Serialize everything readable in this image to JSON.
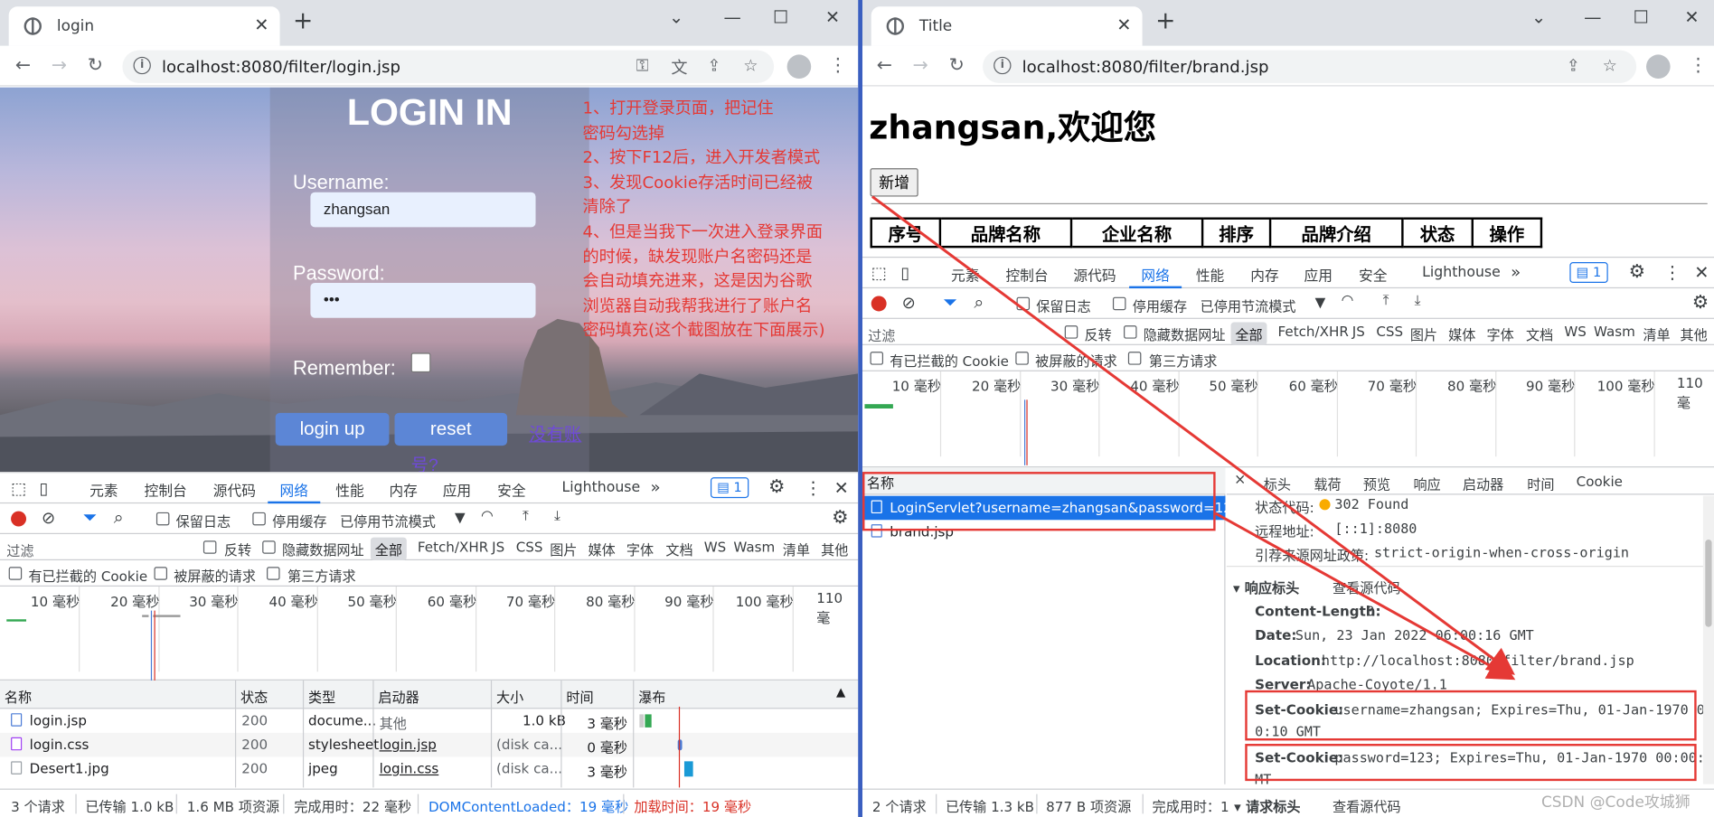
{
  "left": {
    "tab_title": "login",
    "url": "localhost:8080/filter/login.jsp",
    "login": {
      "title": "LOGIN IN",
      "username_label": "Username:",
      "username_value": "zhangsan",
      "password_label": "Password:",
      "password_value": "•••",
      "remember_label": "Remember:",
      "login_button": "login up",
      "reset_button": "reset",
      "register_link": "没有账",
      "register_link_2": "号?"
    },
    "annotation": [
      "1、打开登录页面，把记住",
      "密码勾选掉",
      "2、按下F12后，进入开发者模式",
      "3、发现Cookie存活时间已经被",
      "清除了",
      "4、但是当我下一次进入登录界面",
      "的时候，缺发现账户名密码还是",
      "会自动填充进来，这是因为谷歌",
      "浏览器自动我帮我进行了账户名",
      "密码填充(这个截图放在下面展示)"
    ],
    "devtools": {
      "tabs": [
        "元素",
        "控制台",
        "源代码",
        "网络",
        "性能",
        "内存",
        "应用",
        "安全",
        "Lighthouse"
      ],
      "active_tab": "网络",
      "more": "»",
      "badge": "1",
      "preserve_log": "保留日志",
      "disable_cache": "停用缓存",
      "throttle": "已停用节流模式",
      "filter_placeholder": "过滤",
      "invert": "反转",
      "hide_data_urls": "隐藏数据网址",
      "all": "全部",
      "types": [
        "Fetch/XHR",
        "JS",
        "CSS",
        "图片",
        "媒体",
        "字体",
        "文档",
        "WS",
        "Wasm",
        "清单",
        "其他"
      ],
      "blocked_cookies": "有已拦截的 Cookie",
      "blocked_requests": "被屏蔽的请求",
      "third_party": "第三方请求",
      "ticks": [
        "10 毫秒",
        "20 毫秒",
        "30 毫秒",
        "40 毫秒",
        "50 毫秒",
        "60 毫秒",
        "70 毫秒",
        "80 毫秒",
        "90 毫秒",
        "100 毫秒",
        "110 毫"
      ],
      "columns": [
        "名称",
        "状态",
        "类型",
        "启动器",
        "大小",
        "时间",
        "瀑布"
      ],
      "sort_arrow": "▲",
      "rows": [
        {
          "name": "login.jsp",
          "status": "200",
          "type": "docume...",
          "initiator": "其他",
          "size": "1.0 kB",
          "time": "3 毫秒"
        },
        {
          "name": "login.css",
          "status": "200",
          "type": "stylesheet",
          "initiator": "login.jsp",
          "size": "(disk ca...",
          "time": "0 毫秒"
        },
        {
          "name": "Desert1.jpg",
          "status": "200",
          "type": "jpeg",
          "initiator": "login.css",
          "size": "(disk ca...",
          "time": "3 毫秒"
        }
      ],
      "status": {
        "requests": "3 个请求",
        "transferred": "已传输 1.0 kB",
        "resources": "1.6 MB 项资源",
        "finish": "完成用时：22 毫秒",
        "dcl": "DOMContentLoaded：19 毫秒",
        "load": "加载时间：19 毫秒"
      }
    }
  },
  "right": {
    "tab_title": "Title",
    "url": "localhost:8080/filter/brand.jsp",
    "welcome": "zhangsan,欢迎您",
    "add_button": "新增",
    "table_headers": [
      "序号",
      "品牌名称",
      "企业名称",
      "排序",
      "品牌介绍",
      "状态",
      "操作"
    ],
    "devtools": {
      "tabs": [
        "元素",
        "控制台",
        "源代码",
        "网络",
        "性能",
        "内存",
        "应用",
        "安全",
        "Lighthouse"
      ],
      "active_tab": "网络",
      "more": "»",
      "badge": "1",
      "preserve_log": "保留日志",
      "disable_cache": "停用缓存",
      "throttle": "已停用节流模式",
      "filter_placeholder": "过滤",
      "invert": "反转",
      "hide_data_urls": "隐藏数据网址",
      "all": "全部",
      "types": [
        "Fetch/XHR",
        "JS",
        "CSS",
        "图片",
        "媒体",
        "字体",
        "文档",
        "WS",
        "Wasm",
        "清单",
        "其他"
      ],
      "blocked_cookies": "有已拦截的 Cookie",
      "blocked_requests": "被屏蔽的请求",
      "third_party": "第三方请求",
      "ticks": [
        "10 毫秒",
        "20 毫秒",
        "30 毫秒",
        "40 毫秒",
        "50 毫秒",
        "60 毫秒",
        "70 毫秒",
        "80 毫秒",
        "90 毫秒",
        "100 毫秒",
        "110 毫"
      ],
      "name_header": "名称",
      "requests": [
        "LoginServlet?username=zhangsan&password=123",
        "brand.jsp"
      ],
      "detail_tabs": [
        "标头",
        "载荷",
        "预览",
        "响应",
        "启动器",
        "时间",
        "Cookie"
      ],
      "detail_close": "×",
      "status_code_label": "状态代码:",
      "status_code_value": "302 Found",
      "remote_label": "远程地址:",
      "remote_value": "[::1]:8080",
      "referrer_label": "引荐来源网址政策:",
      "referrer_value": "strict-origin-when-cross-origin",
      "response_headers": "▾ 响应标头",
      "view_source": "查看源代码",
      "headers": [
        {
          "k": "Content-Length:",
          "v": "0"
        },
        {
          "k": "Date:",
          "v": "Sun, 23 Jan 2022 06:00:16 GMT"
        },
        {
          "k": "Location:",
          "v": "http://localhost:8080/filter/brand.jsp"
        },
        {
          "k": "Server:",
          "v": "Apache-Coyote/1.1"
        }
      ],
      "setcookie1_key": "Set-Cookie:",
      "setcookie1_val": "username=zhangsan; Expires=Thu, 01-Jan-1970 00:0",
      "setcookie1_val2": "0:10 GMT",
      "setcookie2_key": "Set-Cookie:",
      "setcookie2_val": "password=123; Expires=Thu, 01-Jan-1970 00:00:10 G",
      "setcookie2_val2": "MT",
      "request_headers": "▾ 请求标头",
      "status": {
        "requests": "2 个请求",
        "transferred": "已传输 1.3 kB",
        "resources": "877 B 项资源",
        "finish": "完成用时：1"
      }
    }
  },
  "watermark": "CSDN @Code攻城狮",
  "colors": {
    "annotation": "#e53935",
    "accent": "#1a73e8",
    "login_button": "#5c86d6"
  }
}
